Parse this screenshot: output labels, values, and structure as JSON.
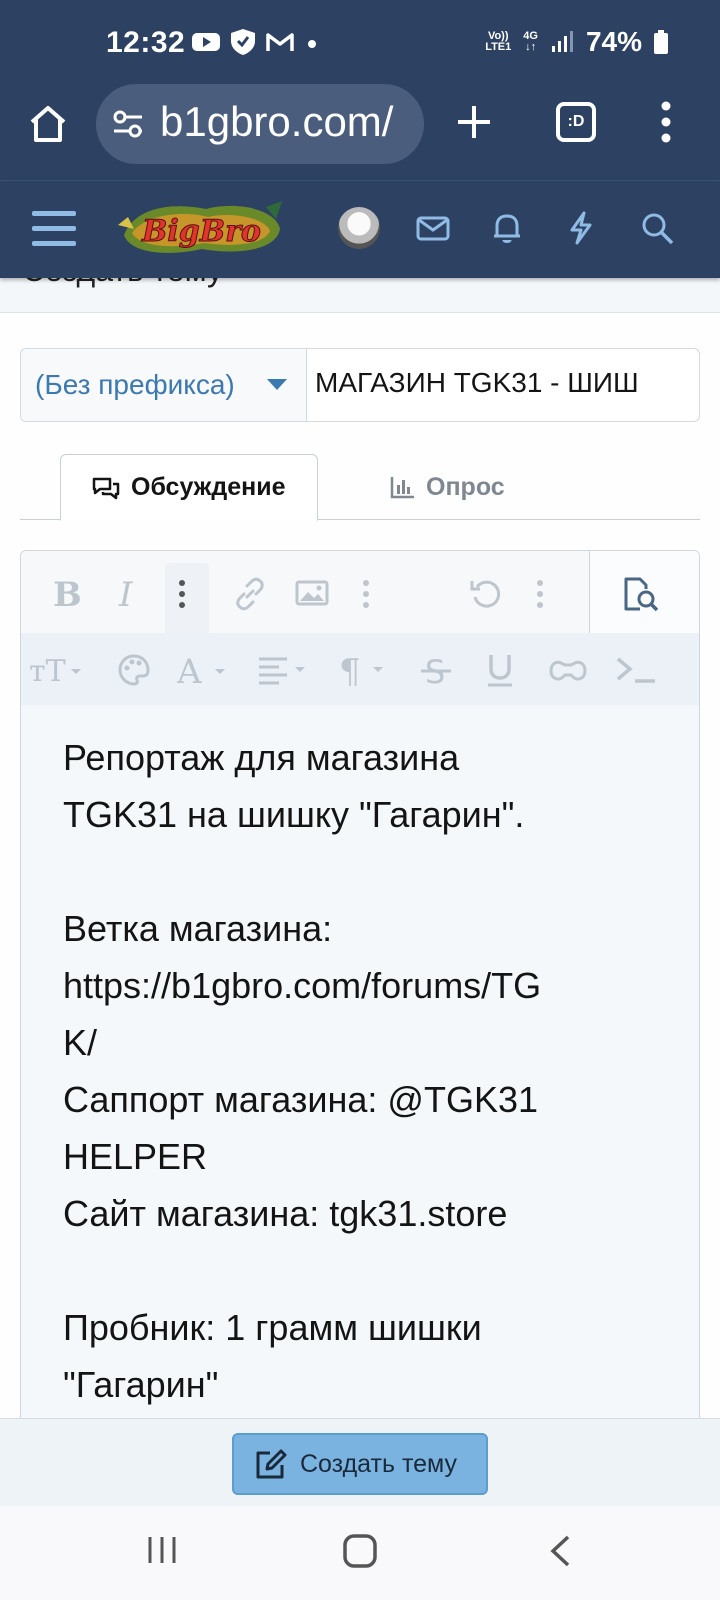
{
  "status_bar": {
    "time": "12:32",
    "network_top": "Vo))",
    "network_bottom": "LTE1",
    "net_type": "4G",
    "battery": "74%",
    "icons": [
      "youtube-icon",
      "vpn-shield-icon",
      "gmail-icon",
      "dot-icon",
      "signal-icon",
      "battery-icon"
    ]
  },
  "browser": {
    "url": "b1gbro.com/",
    "tabs_label": ":D",
    "icons": [
      "home-icon",
      "site-settings-icon",
      "plus-icon",
      "tabs-icon",
      "more-vert-icon"
    ]
  },
  "site_header": {
    "logo_text": "BigBro",
    "icons": [
      "hamburger-icon",
      "avatar",
      "mail-icon",
      "bell-icon",
      "bolt-icon",
      "search-icon"
    ]
  },
  "page": {
    "title_partial": "Создать тему"
  },
  "form": {
    "prefix": "(Без префикса)",
    "title_value": "МАГАЗИН TGK31 - ШИШ",
    "tabs": [
      {
        "label": "Обсуждение",
        "icon": "chat-icon",
        "active": true
      },
      {
        "label": "Опрос",
        "icon": "poll-chart-icon",
        "active": false
      }
    ]
  },
  "editor": {
    "toolbar_row1": [
      "B",
      "I",
      "more-vert-icon",
      "link-icon",
      "image-icon",
      "more-vert-icon",
      "undo-icon",
      "more-vert-icon",
      "preview-icon"
    ],
    "toolbar_row2": [
      "text-size-icon",
      "palette-icon",
      "font-color-icon",
      "align-icon",
      "paragraph-icon",
      "strikethrough-icon",
      "underline-icon",
      "spoiler-icon",
      "code-icon"
    ],
    "lines": [
      "Репортаж для магазина",
      "TGK31 на шишку \"Гагарин\".",
      "",
      "Ветка магазина:",
      "https://b1gbro.com/forums/TG",
      "K/",
      "Саппорт магазина: @TGK31",
      "HELPER",
      "Сайт магазина: tgk31.store",
      "",
      "Пробник: 1 грамм шишки",
      "\"Гагарин\""
    ]
  },
  "submit": {
    "label": "Создать тему"
  },
  "nav": {
    "icons": [
      "recents-icon",
      "home-circle-icon",
      "back-icon"
    ]
  },
  "colors": {
    "header_bg": "#2d4263",
    "accent": "#3b79b1",
    "button_bg": "#7ab3e0"
  }
}
